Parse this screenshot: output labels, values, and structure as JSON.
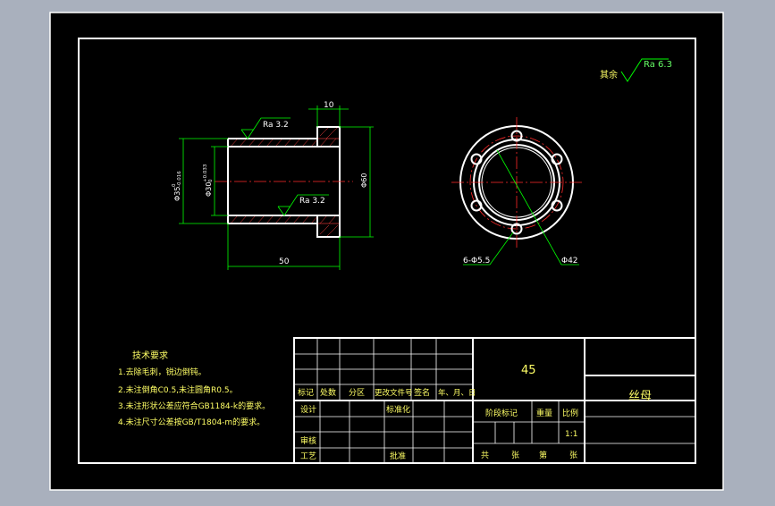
{
  "colors": {
    "background": "#a9b0bd",
    "sheet": "#000000",
    "border": "#ffffff",
    "dimension": "#00ff00",
    "centerline": "#ff2a2a",
    "text_yellow": "#ffff66",
    "text_green": "#66ff66"
  },
  "drawing": {
    "roughness_rest_label": "其余",
    "roughness_rest_value": "Ra 6.3",
    "roughness_top": "Ra 3.2",
    "roughness_inner": "Ra 3.2",
    "dim_flange_width": "10",
    "dim_length": "50",
    "dim_outer_dia": "Φ35",
    "dim_outer_tol_upper": "0",
    "dim_outer_tol_lower": "-0.016",
    "dim_inner_dia": "Φ30",
    "dim_inner_tol_upper": "+0.033",
    "dim_inner_tol_lower": "0",
    "dim_flange_dia": "Φ60",
    "dim_holes": "6-Φ5.5",
    "dim_pitch_circle": "Φ42"
  },
  "notes": {
    "title": "技术要求",
    "items": [
      "1.去除毛刺，锐边倒钝。",
      "2.未注倒角C0.5,未注圆角R0.5。",
      "3.未注形状公差应符合GB1184-k的要求。",
      "4.未注尺寸公差按GB/T1804-m的要求。"
    ]
  },
  "title_block": {
    "material": "45",
    "part_name": "丝母",
    "col_headers": [
      "标记",
      "处数",
      "分区",
      "更改文件号",
      "签名",
      "年、月、日"
    ],
    "design": "设计",
    "standardize": "标准化",
    "review": "审核",
    "process": "工艺",
    "approve": "批准",
    "stage_mark": "阶段标记",
    "weight": "重量",
    "scale": "比例",
    "scale_value": "1:1",
    "total": "共",
    "sheets": "张",
    "sheet_no": "第",
    "sheets2": "张"
  }
}
